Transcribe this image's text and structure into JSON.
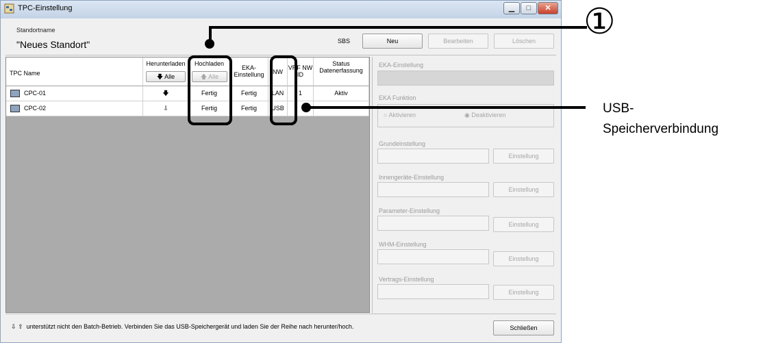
{
  "window": {
    "title": "TPC-Einstellung",
    "minimize_glyph": "▁",
    "maximize_glyph": "□",
    "close_glyph": "✕"
  },
  "site": {
    "label": "Standortname",
    "value": "\"Neues Standort\"",
    "sbs_label": "SBS"
  },
  "actions": {
    "new": "Neu",
    "edit": "Bearbeiten",
    "delete": "Löschen"
  },
  "table": {
    "headers": {
      "name": "TPC Name",
      "download": "Herunterladen",
      "upload": "Hochladen",
      "eka": "EKA-Einstellung",
      "nw": "NW",
      "vrf_nw_id": "VRF NW ID",
      "status": "Status Datenerfassung"
    },
    "download_all": "Alle",
    "upload_all": "Alle",
    "rows": [
      {
        "name": "CPC-01",
        "download_icon": "arrow-down-filled",
        "upload": "Fertig",
        "eka": "Fertig",
        "nw": "LAN",
        "vrf": "1",
        "status": "Aktiv"
      },
      {
        "name": "CPC-02",
        "download_icon": "arrow-down-outline",
        "upload": "Fertig",
        "eka": "Fertig",
        "nw": "USB",
        "vrf": "",
        "status": ""
      }
    ]
  },
  "right_panel": {
    "eka_setting": "EKA-Einstellung",
    "eka_function": "EKA Funktion",
    "activate": "Aktivieren",
    "deactivate": "Deaktivieren",
    "sections": [
      {
        "label": "Grundeinstellung",
        "button": "Einstellung"
      },
      {
        "label": "Innengeräte-Einstellung",
        "button": "Einstellung"
      },
      {
        "label": "Parameter-Einstellung",
        "button": "Einstellung"
      },
      {
        "label": "WHM-Einstellung",
        "button": "Einstellung"
      },
      {
        "label": "Vertrags-Einstellung",
        "button": "Einstellung"
      }
    ]
  },
  "footer": {
    "note": "unterstützt nicht den Batch-Betrieb. Verbinden Sie das USB-Speichergerät und laden Sie der Reihe nach herunter/hoch.",
    "close": "Schließen"
  },
  "annotations": {
    "circle_number": "①",
    "usb_line1": "USB-",
    "usb_line2": "Speicherverbindung"
  },
  "colors": {
    "highlight": "#000000",
    "grid_empty": "#ababab",
    "titlebar": "#c3d3e6"
  }
}
